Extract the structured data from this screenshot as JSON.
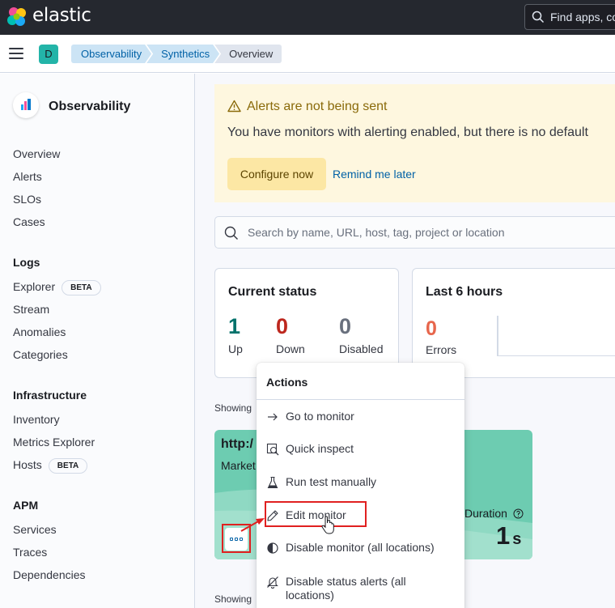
{
  "header": {
    "brand": "elastic",
    "search_placeholder": "Find apps, co"
  },
  "navbar": {
    "space_initial": "D",
    "breadcrumbs": [
      "Observability",
      "Synthetics",
      "Overview"
    ]
  },
  "sidebar": {
    "title": "Observability",
    "top_items": [
      "Overview",
      "Alerts",
      "SLOs",
      "Cases"
    ],
    "groups": [
      {
        "title": "Logs",
        "items": [
          {
            "label": "Explorer",
            "badge": "BETA"
          },
          {
            "label": "Stream"
          },
          {
            "label": "Anomalies"
          },
          {
            "label": "Categories"
          }
        ]
      },
      {
        "title": "Infrastructure",
        "items": [
          {
            "label": "Inventory"
          },
          {
            "label": "Metrics Explorer"
          },
          {
            "label": "Hosts",
            "badge": "BETA"
          }
        ]
      },
      {
        "title": "APM",
        "items": [
          {
            "label": "Services"
          },
          {
            "label": "Traces"
          },
          {
            "label": "Dependencies"
          }
        ]
      }
    ]
  },
  "callout": {
    "title": "Alerts are not being sent",
    "body": "You have monitors with alerting enabled, but there is no default",
    "configure_label": "Configure now",
    "remind_label": "Remind me later"
  },
  "search": {
    "placeholder": "Search by name, URL, host, tag, project or location"
  },
  "current_status": {
    "title": "Current status",
    "stats": [
      {
        "value": "1",
        "label": "Up",
        "color": "#00726b"
      },
      {
        "value": "0",
        "label": "Down",
        "color": "#bd271e"
      },
      {
        "value": "0",
        "label": "Disabled",
        "color": "#69707d"
      }
    ]
  },
  "last_hours": {
    "title": "Last 6 hours",
    "errors_value": "0",
    "errors_label": "Errors",
    "errors_color": "#e7664c"
  },
  "showing_label": "Showing",
  "monitor_card": {
    "name": "http:/",
    "subtitle": "Market",
    "duration_label": "Duration",
    "duration_value": "1",
    "duration_unit": "s",
    "color": "#6dccb1"
  },
  "actions_menu": {
    "title": "Actions",
    "items": [
      {
        "label": "Go to monitor",
        "icon": "arrow-right-icon"
      },
      {
        "label": "Quick inspect",
        "icon": "inspect-icon"
      },
      {
        "label": "Run test manually",
        "icon": "beaker-icon"
      },
      {
        "label": "Edit monitor",
        "icon": "pencil-icon"
      },
      {
        "label": "Disable monitor (all locations)",
        "icon": "contrast-icon"
      },
      {
        "label": "Disable status alerts (all locations)",
        "icon": "bell-slash-icon"
      }
    ]
  },
  "colors": {
    "accent": "#0061a6",
    "highlight": "#e02020"
  }
}
